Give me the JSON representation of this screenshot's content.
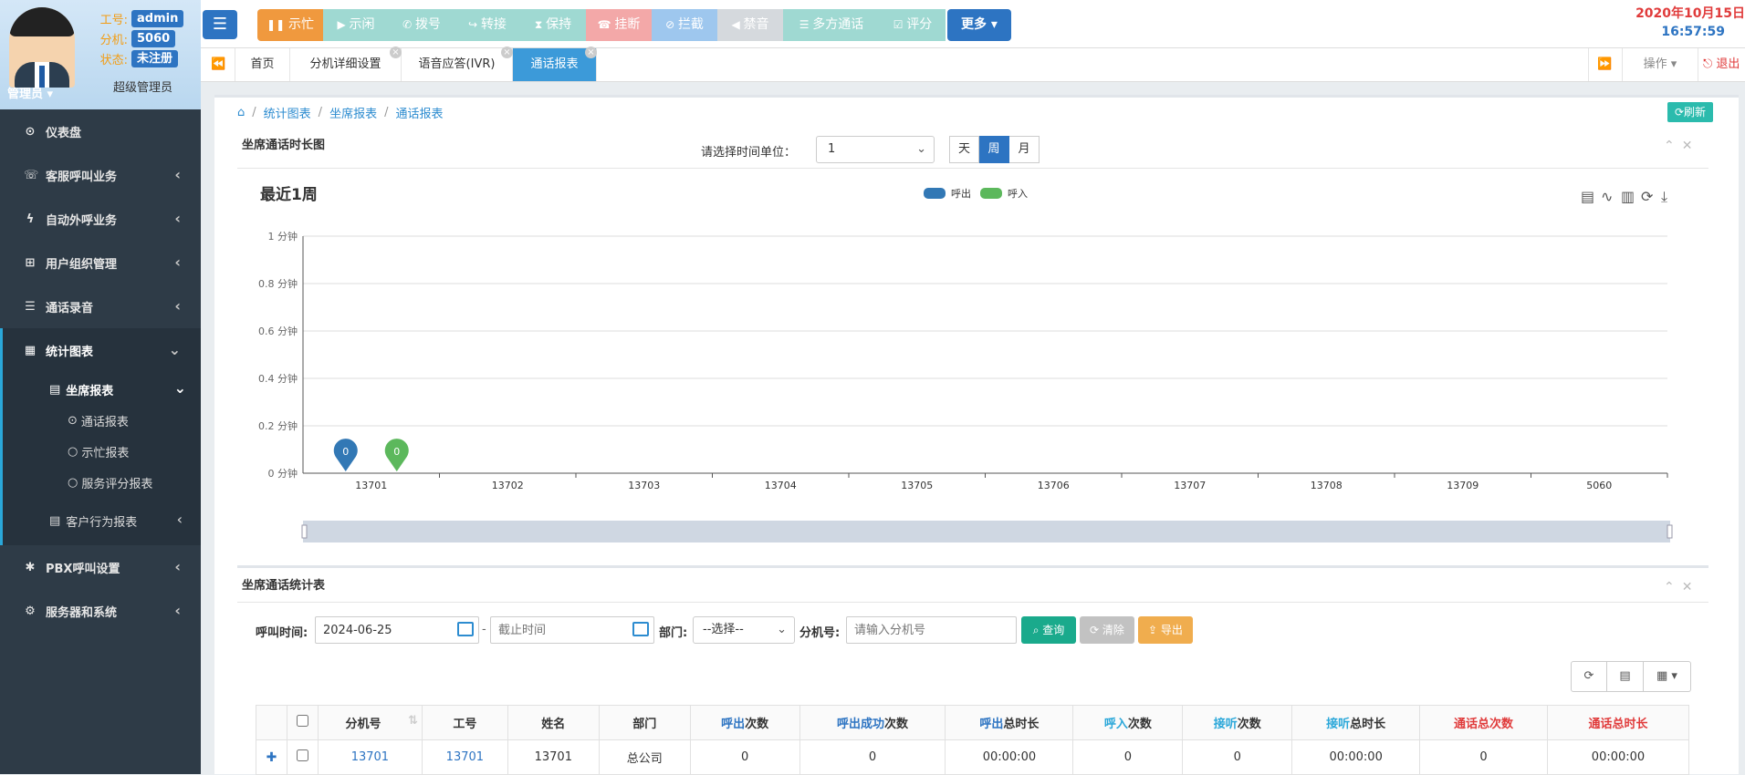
{
  "profile": {
    "labels": {
      "worker_id": "工号:",
      "extension": "分机:",
      "status": "状态:"
    },
    "worker_id": "admin",
    "extension": "5060",
    "status": "未注册",
    "admin_label": "管理员",
    "role": "超级管理员"
  },
  "datetime": {
    "date": "2020年10月15日",
    "time": "16:57:59"
  },
  "toolbar": {
    "buttons": [
      {
        "label": "示忙",
        "icon": "pause-icon",
        "color": "#f0993e"
      },
      {
        "label": "示闲",
        "icon": "play-icon",
        "color": "#9fd9d2"
      },
      {
        "label": "拨号",
        "icon": "phone-icon",
        "color": "#9fd9d2"
      },
      {
        "label": "转接",
        "icon": "share-icon",
        "color": "#9fd9d2"
      },
      {
        "label": "保持",
        "icon": "hourglass-icon",
        "color": "#9fd9d2"
      },
      {
        "label": "挂断",
        "icon": "hangup-icon",
        "color": "#f3a8a8"
      },
      {
        "label": "拦截",
        "icon": "ban-icon",
        "color": "#9ec7ee"
      },
      {
        "label": "禁音",
        "icon": "volume-icon",
        "color": "#d5d9dd"
      },
      {
        "label": "多方通话",
        "icon": "group-icon",
        "color": "#9fd9d2"
      },
      {
        "label": "评分",
        "icon": "check-icon",
        "color": "#9fd9d2"
      },
      {
        "label": "更多",
        "icon": "caret-down-icon",
        "color": "#2d74c2"
      }
    ]
  },
  "tabs": [
    {
      "label": "首页",
      "closable": false,
      "active": false
    },
    {
      "label": "分机详细设置",
      "closable": true,
      "active": false
    },
    {
      "label": "语音应答(IVR)",
      "closable": true,
      "active": false
    },
    {
      "label": "通话报表",
      "closable": true,
      "active": true
    }
  ],
  "tabbar_right": {
    "operate": "操作",
    "logout": "退出"
  },
  "sidebar": {
    "items": [
      {
        "label": "仪表盘",
        "icon": "dashboard-icon",
        "chevron": ""
      },
      {
        "label": "客服呼叫业务",
        "icon": "phone-call-icon",
        "chevron": "‹"
      },
      {
        "label": "自动外呼业务",
        "icon": "bolt-icon",
        "chevron": "‹"
      },
      {
        "label": "用户组织管理",
        "icon": "sitemap-icon",
        "chevron": "‹"
      },
      {
        "label": "通话录音",
        "icon": "list-icon",
        "chevron": "‹"
      },
      {
        "label": "统计图表",
        "icon": "table-icon",
        "chevron": "⌄"
      }
    ],
    "sub_report": {
      "label": "坐席报表"
    },
    "sub_items": [
      {
        "label": "通话报表",
        "active": true
      },
      {
        "label": "示忙报表",
        "active": false
      },
      {
        "label": "服务评分报表",
        "active": false
      }
    ],
    "customer_report": {
      "label": "客户行为报表"
    },
    "bottom_items": [
      {
        "label": "PBX呼叫设置",
        "icon": "asterisk-icon"
      },
      {
        "label": "服务器和系统",
        "icon": "cogs-icon"
      }
    ]
  },
  "breadcrumb": [
    "统计图表",
    "坐席报表",
    "通话报表"
  ],
  "refresh_label": "刷新",
  "chart_panel": {
    "title_pre": "坐席",
    "title_hl": "通话时长",
    "title_post": "图",
    "unit_label": "请选择时间单位：",
    "unit_select": "1",
    "unit_buttons": [
      {
        "label": "天",
        "active": false
      },
      {
        "label": "周",
        "active": true
      },
      {
        "label": "月",
        "active": false
      }
    ]
  },
  "chart_data": {
    "type": "bar",
    "title": "最近1周",
    "categories": [
      "13701",
      "13702",
      "13703",
      "13704",
      "13705",
      "13706",
      "13707",
      "13708",
      "13709",
      "5060"
    ],
    "series": [
      {
        "name": "呼出",
        "color": "#3278b5",
        "values": [
          0,
          0,
          0,
          0,
          0,
          0,
          0,
          0,
          0,
          0
        ]
      },
      {
        "name": "呼入",
        "color": "#5cb85c",
        "values": [
          0,
          0,
          0,
          0,
          0,
          0,
          0,
          0,
          0,
          0
        ]
      }
    ],
    "y_ticks": [
      "0 分钟",
      "0.2 分钟",
      "0.4 分钟",
      "0.6 分钟",
      "0.8 分钟",
      "1 分钟"
    ],
    "ylim": [
      0,
      1
    ],
    "grid": true,
    "legend": "top-center",
    "markers": [
      {
        "series": "呼出",
        "category": "13701",
        "label": "0"
      },
      {
        "series": "呼入",
        "category": "13701",
        "label": "0"
      }
    ]
  },
  "stats_panel": {
    "title_pre": "坐席通话",
    "title_hl": "统计表",
    "filters": {
      "time_label": "呼叫时间:",
      "start_value": "2024-06-25",
      "end_placeholder": "截止时间",
      "dept_label": "部门:",
      "dept_value": "--选择--",
      "ext_label": "分机号:",
      "ext_placeholder": "请输入分机号",
      "search_btn": "查询",
      "clear_btn": "清除",
      "export_btn": "导出"
    },
    "columns": [
      {
        "pre": "",
        "hl": "",
        "post": "分机号",
        "style": ""
      },
      {
        "pre": "",
        "hl": "",
        "post": "工号",
        "style": ""
      },
      {
        "pre": "",
        "hl": "",
        "post": "姓名",
        "style": ""
      },
      {
        "pre": "",
        "hl": "",
        "post": "部门",
        "style": ""
      },
      {
        "pre": "",
        "hl": "呼出",
        "post": "次数",
        "style": "blue"
      },
      {
        "pre": "",
        "hl": "呼出成功",
        "post": "次数",
        "style": "blue"
      },
      {
        "pre": "",
        "hl": "呼出",
        "post": "总时长",
        "style": "blue"
      },
      {
        "pre": "",
        "hl": "呼入",
        "post": "次数",
        "style": "cyan"
      },
      {
        "pre": "",
        "hl": "接听",
        "post": "次数",
        "style": "cyan"
      },
      {
        "pre": "",
        "hl": "接听",
        "post": "总时长",
        "style": "cyan"
      },
      {
        "pre": "",
        "hl": "通话总次数",
        "post": "",
        "style": "red"
      },
      {
        "pre": "",
        "hl": "通话总时长",
        "post": "",
        "style": "red"
      }
    ],
    "rows": [
      {
        "cells": [
          "13701",
          "13701",
          "13701",
          "总公司",
          "0",
          "0",
          "00:00:00",
          "0",
          "0",
          "00:00:00",
          "0",
          "00:00:00"
        ]
      }
    ]
  }
}
